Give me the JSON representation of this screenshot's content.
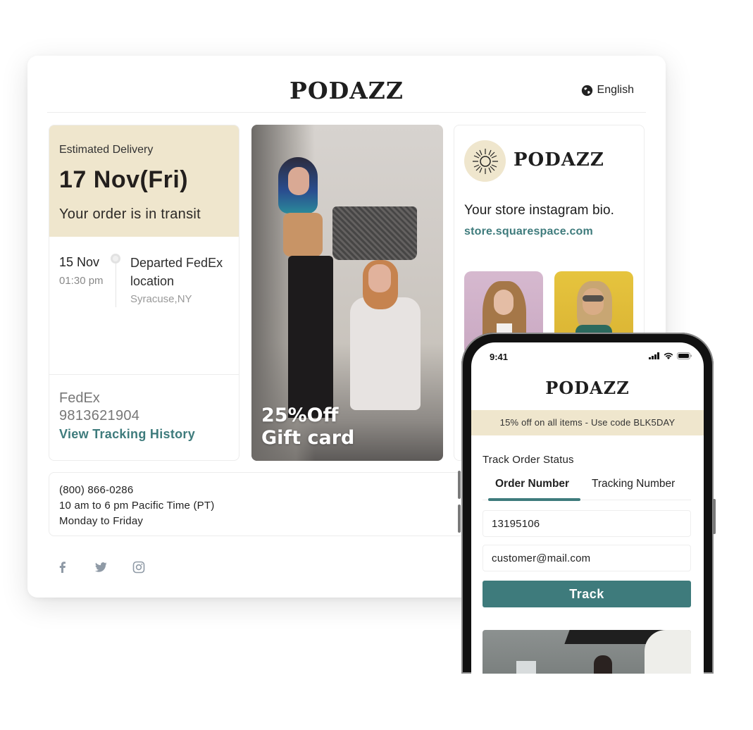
{
  "desktop": {
    "brand": "PODAZZ",
    "language": {
      "icon": "globe-icon",
      "label": "English"
    },
    "delivery": {
      "label": "Estimated Delivery",
      "date": "17 Nov(Fri)",
      "status": "Your order is in transit",
      "event": {
        "date": "15 Nov",
        "time": "01:30 pm",
        "title": "Departed FedEx location",
        "location": "Syracuse,NY"
      },
      "carrier": "FedEx",
      "tracking_number": "9813621904",
      "history_link": "View Tracking History"
    },
    "promo": {
      "line1": "25%Off",
      "line2": "Gift card"
    },
    "instagram": {
      "avatar_icon": "sun-icon",
      "brand": "PODAZZ",
      "bio": "Your store instagram bio.",
      "link": "store.squarespace.com"
    },
    "contact": {
      "phone": "(800) 866-0286",
      "hours": "10 am to 6 pm Pacific Time (PT)",
      "days": "Monday to Friday"
    },
    "social": [
      "facebook-icon",
      "twitter-icon",
      "instagram-icon"
    ]
  },
  "phone": {
    "time": "9:41",
    "brand": "PODAZZ",
    "banner": "15% off on all items - Use code BLK5DAY",
    "track_title": "Track Order Status",
    "tabs": [
      {
        "label": "Order Number",
        "active": true
      },
      {
        "label": "Tracking Number",
        "active": false
      }
    ],
    "order_number_value": "13195106",
    "email_value": "customer@mail.com",
    "track_button": "Track"
  },
  "colors": {
    "accent": "#3e7b7c",
    "beige": "#efe6cd"
  }
}
